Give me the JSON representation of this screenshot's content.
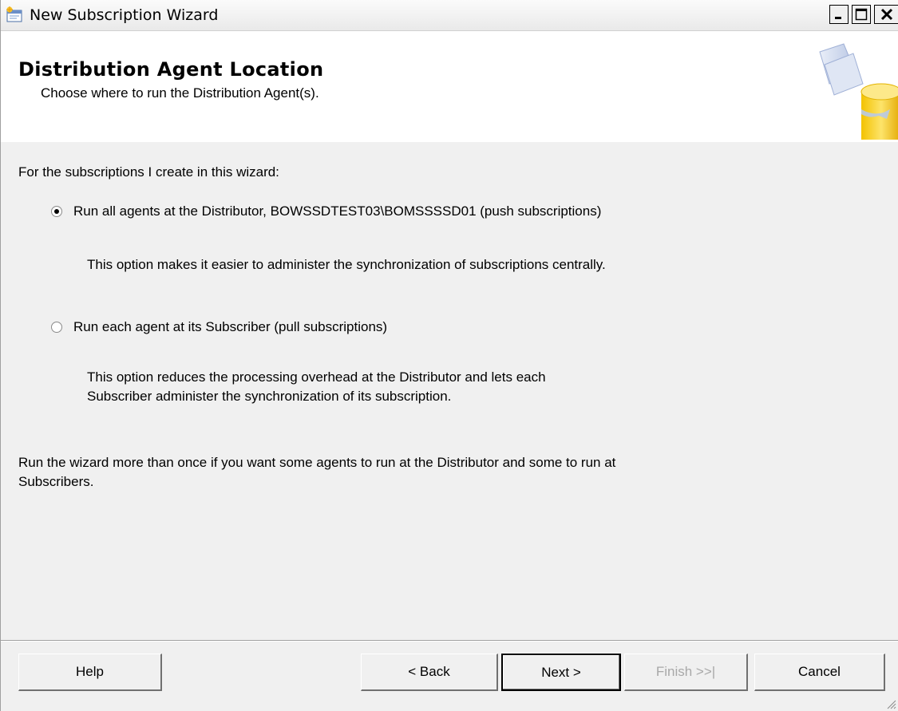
{
  "window": {
    "title": "New Subscription Wizard",
    "controls": [
      "minimize-icon",
      "maximize-icon",
      "close-icon"
    ]
  },
  "header": {
    "title": "Distribution Agent Location",
    "subtitle": "Choose where to run the Distribution Agent(s)."
  },
  "main": {
    "intro": "For the subscriptions I create in this wizard:",
    "options": [
      {
        "label": "Run all agents at the Distributor, BOWSSDTEST03\\BOMSSSSD01 (push subscriptions)",
        "selected": true,
        "description": [
          "This option makes it easier to administer the synchronization of subscriptions centrally."
        ]
      },
      {
        "label": "Run each agent at its Subscriber (pull subscriptions)",
        "selected": false,
        "description": [
          "This option reduces the processing overhead at the Distributor and lets each",
          "Subscriber administer the synchronization of its subscription."
        ]
      }
    ],
    "note": [
      "Run the wizard more than once if you want some agents to run at the Distributor and some to run at",
      "Subscribers."
    ]
  },
  "footer": {
    "help": "Help",
    "back": "< Back",
    "next": "Next >",
    "finish": "Finish >>|",
    "cancel": "Cancel"
  },
  "colors": {
    "dialog_bg": "#f0f0f0",
    "header_bg": "#ffffff",
    "disabled_text": "#a8a8a8"
  }
}
